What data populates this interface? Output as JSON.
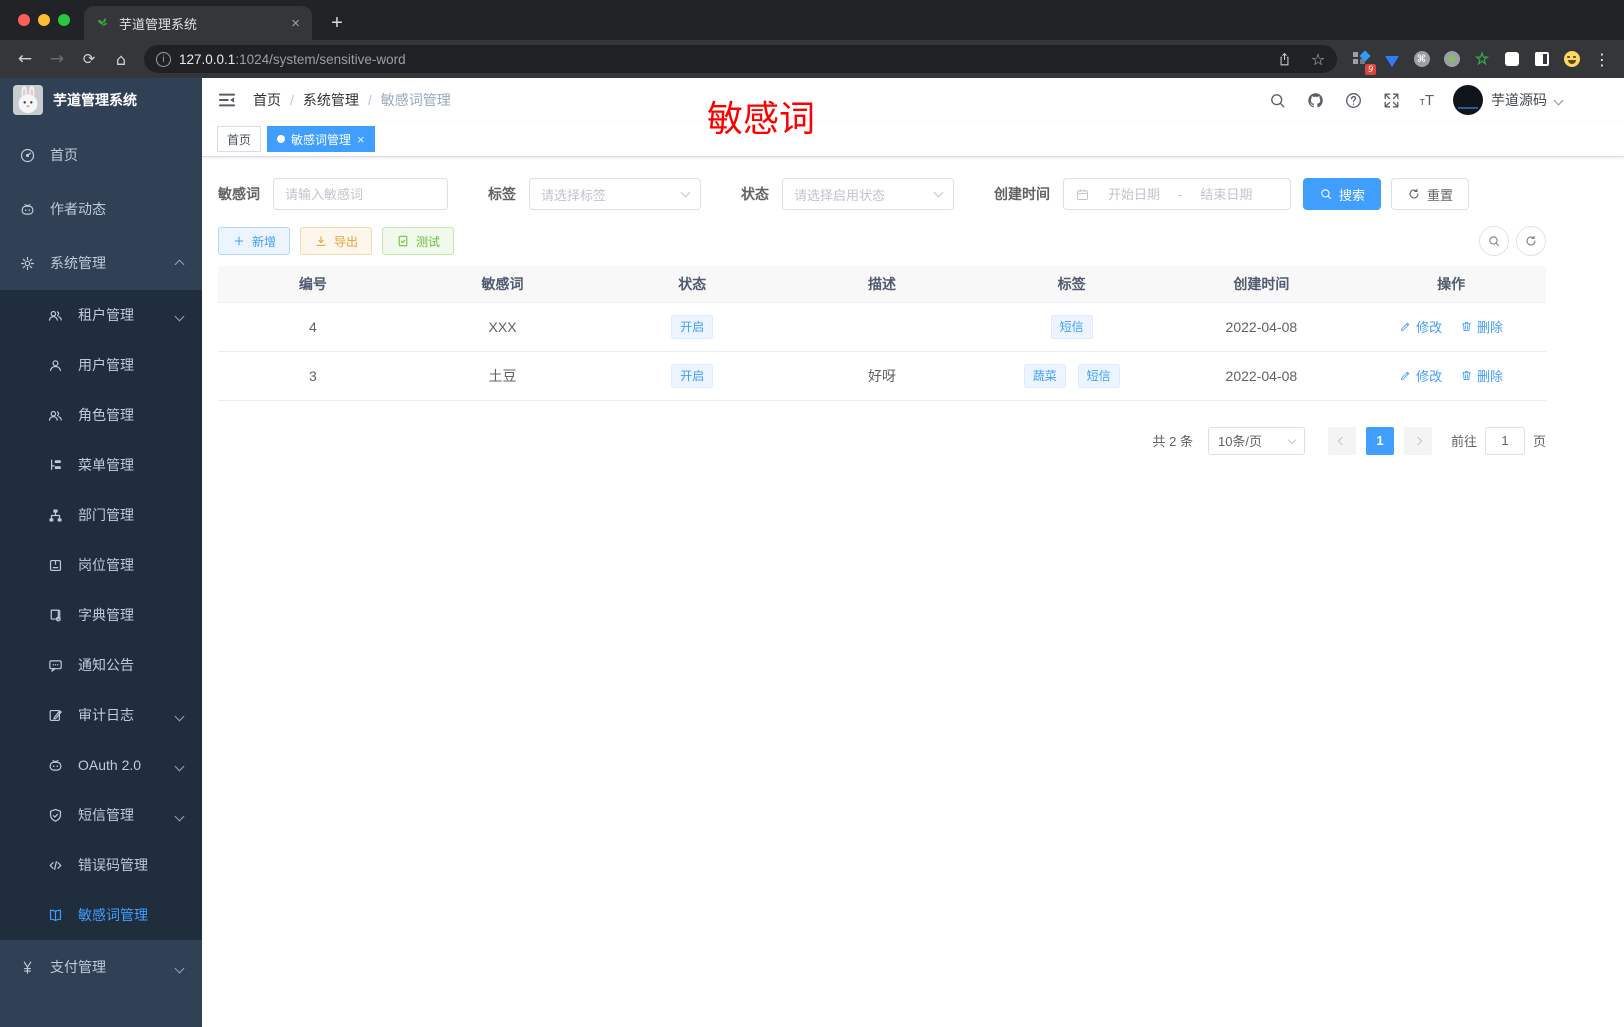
{
  "colors": {
    "accent": "#409eff",
    "annotation_red": "#ff0000",
    "sidebar_bg": "#304156",
    "submenu_bg": "#1f2d3d",
    "success_green": "#67c23a",
    "warning_yellow": "#e6a23c",
    "tag_bg": "#ecf5ff"
  },
  "browser": {
    "tab_title": "芋道管理系统",
    "new_tab": "+",
    "close_tab": "×",
    "url_host": "127.0.0.1",
    "url_rest": ":1024/system/sensitive-word",
    "extension_badge": "9"
  },
  "sidebar": {
    "logo_title": "芋道管理系统",
    "items": [
      {
        "label": "首页",
        "icon": "#i-gauge"
      },
      {
        "label": "作者动态",
        "icon": "#i-robot"
      },
      {
        "label": "系统管理",
        "icon": "#i-gear"
      },
      {
        "label": "租户管理",
        "icon": "#i-users"
      },
      {
        "label": "用户管理",
        "icon": "#i-user"
      },
      {
        "label": "角色管理",
        "icon": "#i-users"
      },
      {
        "label": "菜单管理",
        "icon": "#i-tree"
      },
      {
        "label": "部门管理",
        "icon": "#i-dept"
      },
      {
        "label": "岗位管理",
        "icon": "#i-badge"
      },
      {
        "label": "字典管理",
        "icon": "#i-dict"
      },
      {
        "label": "通知公告",
        "icon": "#i-notice"
      },
      {
        "label": "审计日志",
        "icon": "#i-log"
      },
      {
        "label": "OAuth 2.0",
        "icon": "#i-robot"
      },
      {
        "label": "短信管理",
        "icon": "#i-shield"
      },
      {
        "label": "错误码管理",
        "icon": "#i-code"
      },
      {
        "label": "敏感词管理",
        "icon": "#i-book"
      },
      {
        "label": "支付管理",
        "icon": "#i-yen"
      }
    ]
  },
  "header": {
    "breadcrumb": [
      "首页",
      "系统管理",
      "敏感词管理"
    ],
    "separator": "/",
    "username": "芋道源码"
  },
  "annotation": {
    "text": "敏感词"
  },
  "tags_view": {
    "home_tab": "首页",
    "active_tab": "敏感词管理",
    "close": "×"
  },
  "filters": {
    "keyword_label": "敏感词",
    "keyword_placeholder": "请输入敏感词",
    "tag_label": "标签",
    "tag_placeholder": "请选择标签",
    "status_label": "状态",
    "status_placeholder": "请选择启用状态",
    "date_label": "创建时间",
    "date_start_placeholder": "开始日期",
    "date_separator": "-",
    "date_end_placeholder": "结束日期",
    "search_label": "搜索",
    "reset_label": "重置"
  },
  "toolbar": {
    "add_label": "新增",
    "export_label": "导出",
    "test_label": "测试"
  },
  "table": {
    "headers": [
      "编号",
      "敏感词",
      "状态",
      "描述",
      "标签",
      "创建时间",
      "操作"
    ],
    "action_edit": "修改",
    "action_delete": "删除",
    "rows": [
      {
        "id": "4",
        "word": "XXX",
        "status": "开启",
        "description": "",
        "tags": [
          "短信"
        ],
        "created": "2022-04-08"
      },
      {
        "id": "3",
        "word": "土豆",
        "status": "开启",
        "description": "好呀",
        "tags": [
          "蔬菜",
          "短信"
        ],
        "created": "2022-04-08"
      }
    ]
  },
  "pagination": {
    "total": "共 2 条",
    "page_size": "10条/页",
    "current_page": "1",
    "goto_label": "前往",
    "goto_value": "1",
    "unit_label": "页"
  }
}
